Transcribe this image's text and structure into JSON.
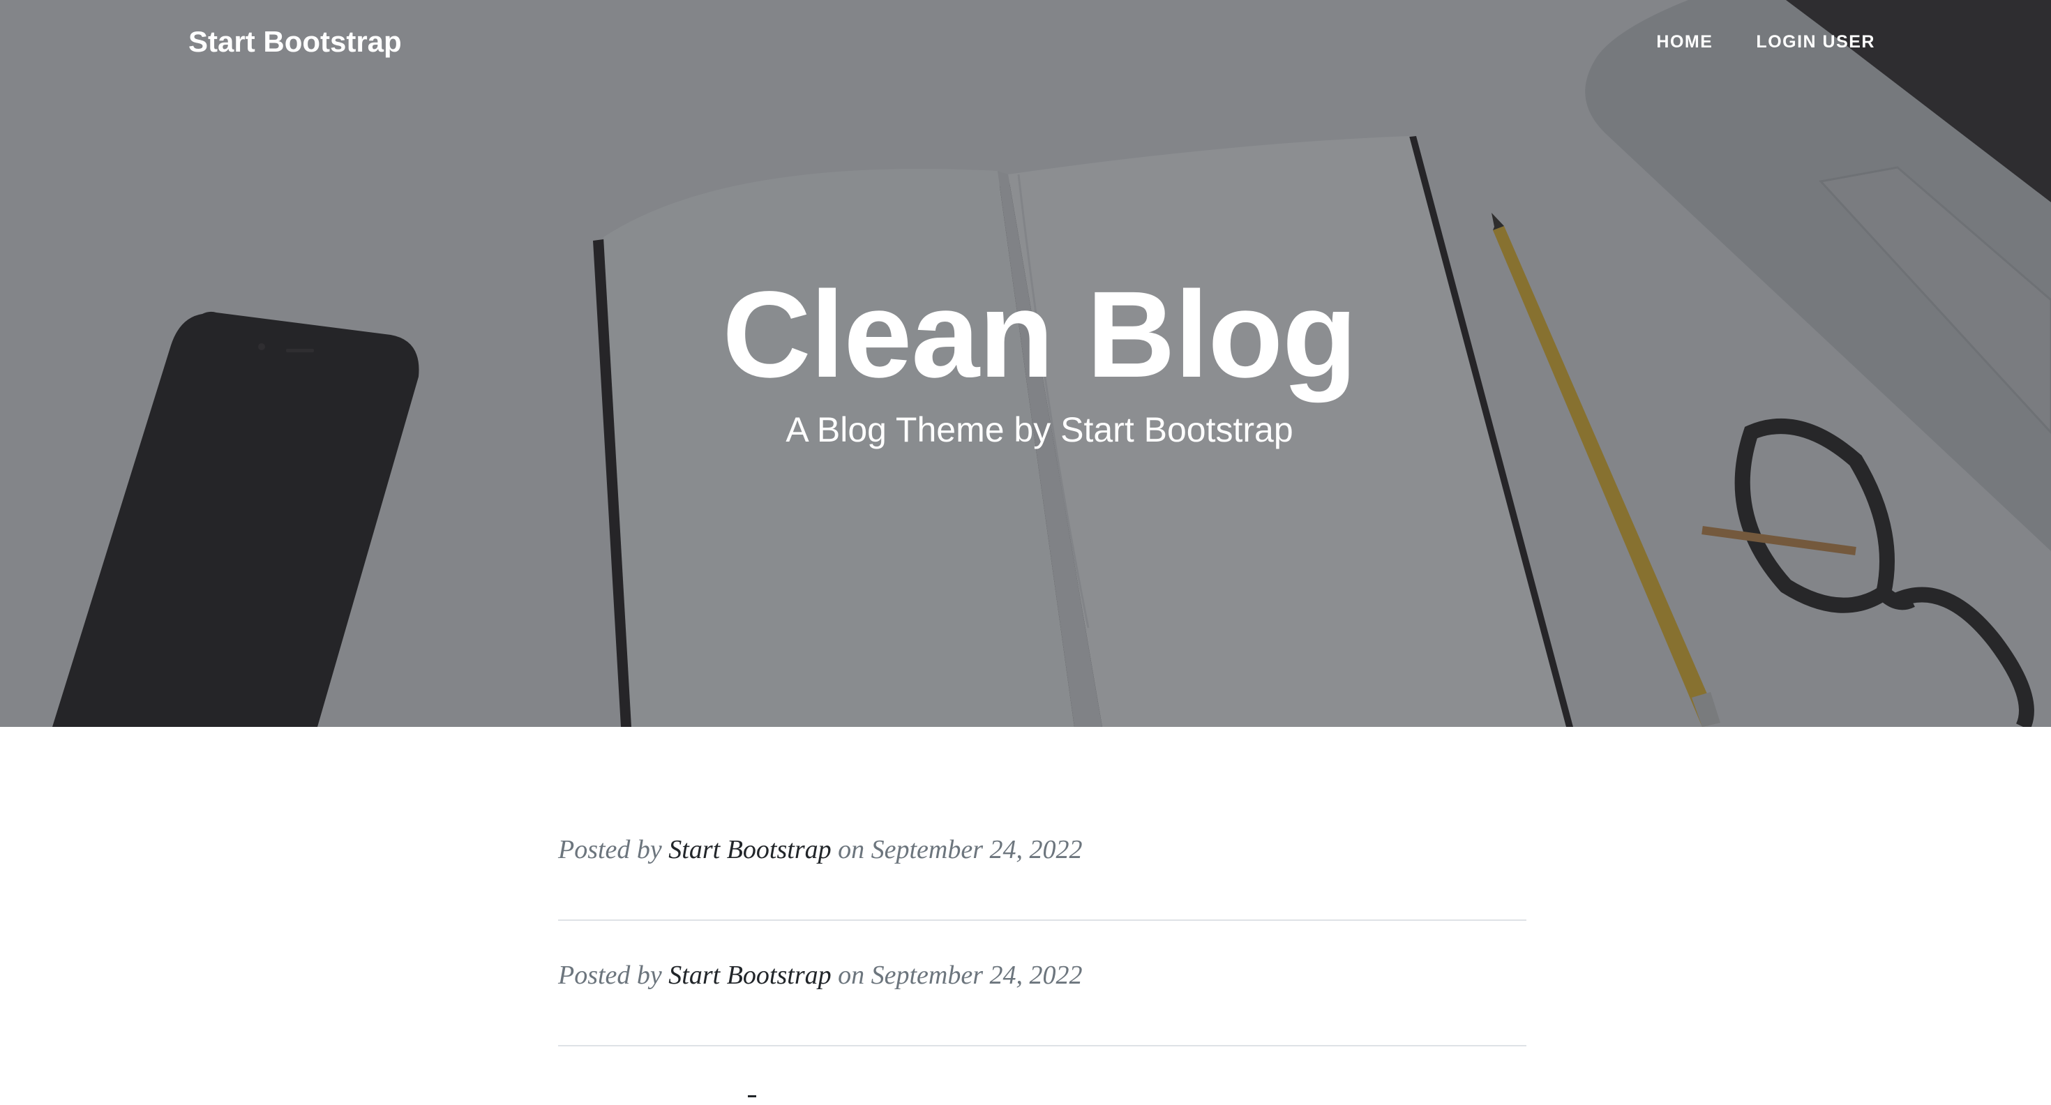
{
  "navbar": {
    "brand": "Start Bootstrap",
    "links": [
      {
        "label": "HOME"
      },
      {
        "label": "LOGIN USER"
      }
    ]
  },
  "hero": {
    "title": "Clean Blog",
    "subtitle": "A Blog Theme by Start Bootstrap"
  },
  "posts": [
    {
      "posted_by_prefix": "Posted by ",
      "author": "Start Bootstrap",
      "on_prefix": " on ",
      "date": "September 24, 2022"
    },
    {
      "posted_by_prefix": "Posted by ",
      "author": "Start Bootstrap",
      "on_prefix": " on ",
      "date": "September 24, 2022"
    }
  ],
  "colors": {
    "overlay": "#212529",
    "text_muted": "#6c757d",
    "text_dark": "#212529",
    "divider": "#dee2e6",
    "pencil": "#e0b43a"
  }
}
